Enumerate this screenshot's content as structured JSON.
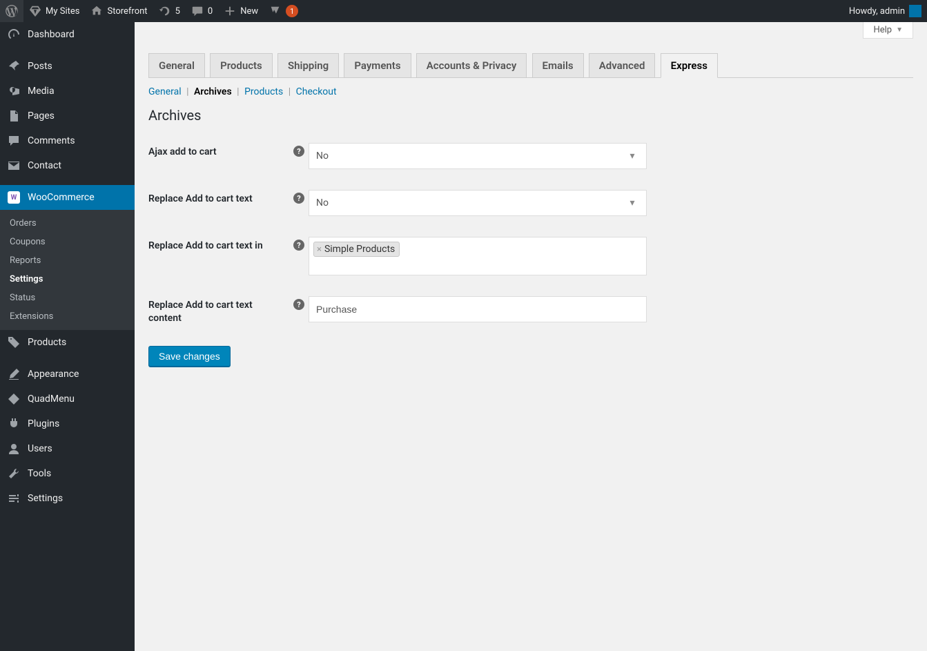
{
  "adminbar": {
    "mysites": "My Sites",
    "sitename": "Storefront",
    "updates": "5",
    "comments": "0",
    "new": "New",
    "yoast_badge": "1",
    "howdy": "Howdy, admin"
  },
  "sidebar": {
    "items": [
      {
        "label": "Dashboard"
      },
      {
        "label": "Posts"
      },
      {
        "label": "Media"
      },
      {
        "label": "Pages"
      },
      {
        "label": "Comments"
      },
      {
        "label": "Contact"
      },
      {
        "label": "WooCommerce"
      },
      {
        "label": "Products"
      },
      {
        "label": "Appearance"
      },
      {
        "label": "QuadMenu"
      },
      {
        "label": "Plugins"
      },
      {
        "label": "Users"
      },
      {
        "label": "Tools"
      },
      {
        "label": "Settings"
      }
    ],
    "submenu": [
      {
        "label": "Orders"
      },
      {
        "label": "Coupons"
      },
      {
        "label": "Reports"
      },
      {
        "label": "Settings"
      },
      {
        "label": "Status"
      },
      {
        "label": "Extensions"
      }
    ]
  },
  "help_label": "Help",
  "tabs": [
    {
      "label": "General"
    },
    {
      "label": "Products"
    },
    {
      "label": "Shipping"
    },
    {
      "label": "Payments"
    },
    {
      "label": "Accounts & Privacy"
    },
    {
      "label": "Emails"
    },
    {
      "label": "Advanced"
    },
    {
      "label": "Express"
    }
  ],
  "subtabs": {
    "general": "General",
    "archives": "Archives",
    "products": "Products",
    "checkout": "Checkout"
  },
  "section_title": "Archives",
  "fields": {
    "ajax": {
      "label": "Ajax add to cart",
      "value": "No"
    },
    "replace_text": {
      "label": "Replace Add to cart text",
      "value": "No"
    },
    "replace_text_in": {
      "label": "Replace Add to cart text in",
      "tag": "Simple Products"
    },
    "replace_text_content": {
      "label": "Replace Add to cart text content",
      "value": "Purchase"
    }
  },
  "save_label": "Save changes"
}
